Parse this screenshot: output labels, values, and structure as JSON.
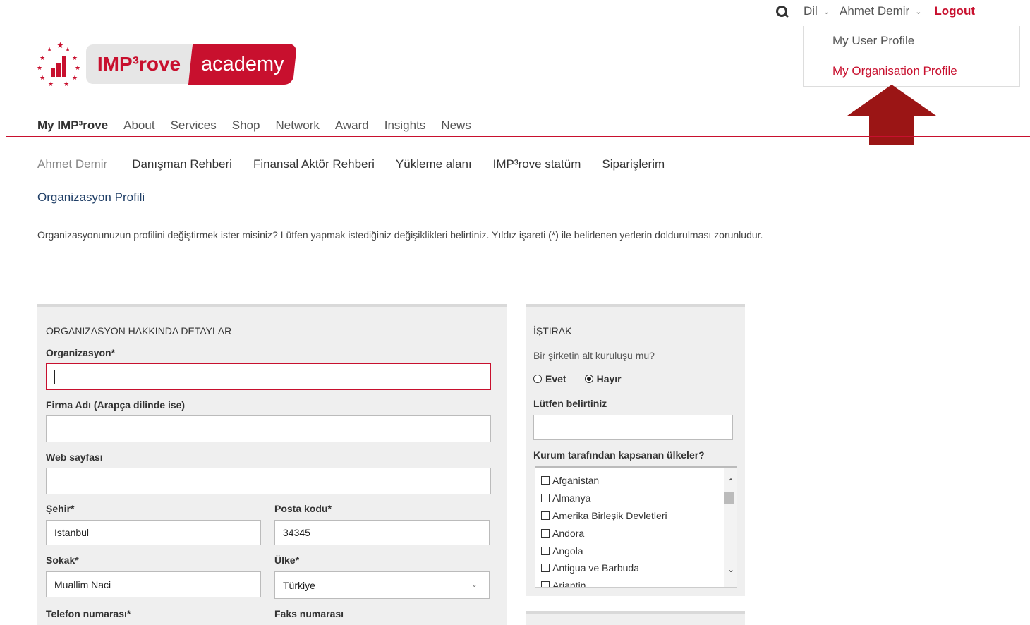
{
  "topbar": {
    "language_label": "Dil",
    "user_name": "Ahmet Demir",
    "logout_label": "Logout"
  },
  "user_menu": {
    "items": [
      {
        "label": "My User Profile"
      },
      {
        "label": "My Organisation Profile"
      }
    ]
  },
  "logo": {
    "brand_word": "IMP³rove",
    "brand_suffix": "academy"
  },
  "main_nav": {
    "items": [
      {
        "label": "My IMP³rove"
      },
      {
        "label": "About"
      },
      {
        "label": "Services"
      },
      {
        "label": "Shop"
      },
      {
        "label": "Network"
      },
      {
        "label": "Award"
      },
      {
        "label": "Insights"
      },
      {
        "label": "News"
      }
    ]
  },
  "sub_nav": {
    "items": [
      {
        "label": "Ahmet Demir"
      },
      {
        "label": "Danışman Rehberi"
      },
      {
        "label": "Finansal Aktör Rehberi"
      },
      {
        "label": "Yükleme alanı"
      },
      {
        "label": "IMP³rove statüm"
      },
      {
        "label": "Siparişlerim"
      }
    ]
  },
  "page": {
    "section_title": "Organizasyon Profili",
    "intro": "Organizasyonunuzun profilini değiştirmek ister misiniz? Lütfen yapmak istediğiniz değişiklikleri belirtiniz. Yıldız işareti (*) ile belirlenen yerlerin doldurulması zorunludur."
  },
  "org_details": {
    "title": "ORGANIZASYON HAKKINDA DETAYLAR",
    "organization_label": "Organizasyon*",
    "organization_value": "",
    "arabic_name_label": "Firma Adı (Arapça dilinde ise)",
    "arabic_name_value": "",
    "website_label": "Web sayfası",
    "website_value": "",
    "city_label": "Şehir*",
    "city_value": "Istanbul",
    "postal_label": "Posta kodu*",
    "postal_value": "34345",
    "street_label": "Sokak*",
    "street_value": "Muallim Naci",
    "country_label": "Ülke*",
    "country_value": "Türkiye",
    "phone_label": "Telefon numarası*",
    "fax_label": "Faks numarası"
  },
  "affiliation": {
    "title": "İŞTIRAK",
    "question": "Bir şirketin alt kuruluşu mu?",
    "option_yes": "Evet",
    "option_no": "Hayır",
    "selected": "Hayır",
    "specify_label": "Lütfen belirtiniz",
    "specify_value": "",
    "countries_label": "Kurum tarafından kapsanan ülkeler?",
    "countries": [
      {
        "label": "Afganistan"
      },
      {
        "label": "Almanya"
      },
      {
        "label": "Amerika Birleşik Devletleri"
      },
      {
        "label": "Andora"
      },
      {
        "label": "Angola"
      },
      {
        "label": "Antigua ve Barbuda"
      },
      {
        "label": "Arjantin"
      }
    ]
  },
  "colors": {
    "brand_red": "#c8102e",
    "annotation_arrow": "#9b1515",
    "link_blue": "#1f3e66",
    "panel_bg": "#efefef"
  }
}
